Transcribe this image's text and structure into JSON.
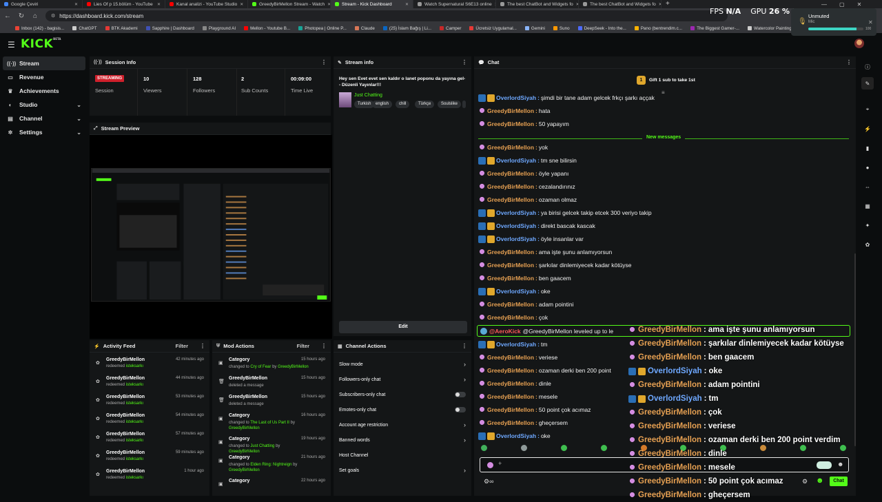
{
  "browser": {
    "tabs": [
      {
        "title": "Google Çeviri",
        "color": "#4285f4",
        "active": false
      },
      {
        "title": "Lies Of p 15.bölüm - YouTube",
        "color": "#ff0000",
        "active": false
      },
      {
        "title": "Kanal analizi - YouTube Studio",
        "color": "#ff0000",
        "active": false
      },
      {
        "title": "GreedyBirMellon Stream - Watch",
        "color": "#53fc18",
        "active": false
      },
      {
        "title": "Stream - Kick Dashboard",
        "color": "#53fc18",
        "active": true
      },
      {
        "title": "Watch Supernatural S6E13 online",
        "color": "#999999",
        "active": false
      },
      {
        "title": "The best ChatBot and Widgets fo",
        "color": "#999999",
        "active": false
      },
      {
        "title": "The best ChatBot and Widgets fo",
        "color": "#999999",
        "active": false
      }
    ],
    "url": "https://dashboard.kick.com/stream",
    "bookmarks": [
      {
        "label": "Inbox (142) - bagisis...",
        "color": "#ea4335"
      },
      {
        "label": "ChatGPT",
        "color": "#cccccc"
      },
      {
        "label": "BTK Akademi",
        "color": "#e53935"
      },
      {
        "label": "Sapphire | Dashboard",
        "color": "#3f51b5"
      },
      {
        "label": "Playground AI",
        "color": "#888888"
      },
      {
        "label": "Mellon - Youtube B...",
        "color": "#ff0000"
      },
      {
        "label": "Photopea | Online P...",
        "color": "#18a497"
      },
      {
        "label": "Claude",
        "color": "#d97757"
      },
      {
        "label": "(25) İslam Bağış | Li...",
        "color": "#0a66c2"
      },
      {
        "label": "Camper",
        "color": "#c62828"
      },
      {
        "label": "Ücretsiz Uygulamal...",
        "color": "#e53935"
      },
      {
        "label": "Gemini",
        "color": "#8ab4f8"
      },
      {
        "label": "Suno",
        "color": "#ff9800"
      },
      {
        "label": "DeepSeek - Into the...",
        "color": "#4d6bfe"
      },
      {
        "label": "Pano (bentrendim.c...",
        "color": "#ffb300"
      },
      {
        "label": "The Biggest Gamer-...",
        "color": "#9c27b0"
      },
      {
        "label": "Watercolor Painting...",
        "color": "#cccccc"
      },
      {
        "label": "AI Image Gener...",
        "color": "#cccccc"
      }
    ]
  },
  "overlay": {
    "fps_label": "FPS",
    "fps_value": "N/A",
    "gpu_label": "GPU",
    "gpu_value": "26 %",
    "gpu_extra": "50",
    "mic_title": "Unmuted",
    "mic_sub": "Mic",
    "mic_level_pct": 88,
    "mic_value": "100"
  },
  "app": {
    "logo": "KICK",
    "logo_badge": "BETA",
    "sidebar": [
      {
        "label": "Stream",
        "icon": "broadcast-icon",
        "glyph": "((·))",
        "active": true,
        "expand": false
      },
      {
        "label": "Revenue",
        "icon": "revenue-icon",
        "glyph": "▭",
        "active": false,
        "expand": false
      },
      {
        "label": "Achievements",
        "icon": "trophy-icon",
        "glyph": "♛",
        "active": false,
        "expand": false
      },
      {
        "label": "Studio",
        "icon": "studio-icon",
        "glyph": "◐",
        "active": false,
        "expand": true
      },
      {
        "label": "Channel",
        "icon": "channel-icon",
        "glyph": "▤",
        "active": false,
        "expand": true
      },
      {
        "label": "Settings",
        "icon": "gear-icon",
        "glyph": "✲",
        "active": false,
        "expand": true
      }
    ]
  },
  "session": {
    "title": "Session Info",
    "status": "STREAMING",
    "session_label": "Session",
    "stats": [
      {
        "value": "10",
        "label": "Viewers"
      },
      {
        "value": "128",
        "label": "Followers"
      },
      {
        "value": "2",
        "label": "Sub Counts"
      },
      {
        "value": "00:09:00",
        "label": "Time Live"
      }
    ]
  },
  "stream_info": {
    "title": "Stream info",
    "stream_title": "Hey sen Evet evet sen kaldır o lanet poponu da yayına gel- - Düzenli Yayınlar!!!",
    "category": "Just Chatting",
    "tags": [
      "Turkish",
      "english",
      "chill",
      "Türkçe",
      "Soulslike"
    ],
    "edit_label": "Edit"
  },
  "preview": {
    "title": "Stream Preview"
  },
  "activity": {
    "title": "Activity Feed",
    "filter": "Filter",
    "items": [
      {
        "user": "GreedyBirMellon",
        "action": "redeemed",
        "reward": "isteksarkı",
        "time": "42 minutes ago"
      },
      {
        "user": "GreedyBirMellon",
        "action": "redeemed",
        "reward": "isteksarkı",
        "time": "44 minutes ago"
      },
      {
        "user": "GreedyBirMellon",
        "action": "redeemed",
        "reward": "isteksarkı",
        "time": "53 minutes ago"
      },
      {
        "user": "GreedyBirMellon",
        "action": "redeemed",
        "reward": "isteksarkı",
        "time": "54 minutes ago"
      },
      {
        "user": "GreedyBirMellon",
        "action": "redeemed",
        "reward": "isteksarkı",
        "time": "57 minutes ago"
      },
      {
        "user": "GreedyBirMellon",
        "action": "redeemed",
        "reward": "isteksarkı",
        "time": "59 minutes ago"
      },
      {
        "user": "GreedyBirMellon",
        "action": "redeemed",
        "reward": "isteksarkı",
        "time": "1 hour ago"
      }
    ]
  },
  "mod_actions": {
    "title": "Mod Actions",
    "filter": "Filter",
    "items": [
      {
        "head": "Category",
        "pre": "changed to",
        "target": "Cry of Fear",
        "mid": "by",
        "by": "GreedyBirMellon",
        "time": "15 hours ago",
        "icon": "category-icon",
        "glyph": "▣"
      },
      {
        "head": "GreedyBirMellon",
        "pre": "deleted a message",
        "target": "",
        "mid": "",
        "by": "",
        "time": "15 hours ago",
        "icon": "trash-icon",
        "glyph": "🗑"
      },
      {
        "head": "GreedyBirMellon",
        "pre": "deleted a message",
        "target": "",
        "mid": "",
        "by": "",
        "time": "15 hours ago",
        "icon": "trash-icon",
        "glyph": "🗑"
      },
      {
        "head": "Category",
        "pre": "changed to",
        "target": "The Last of Us Part II",
        "mid": "by",
        "by": "GreedyBirMellon",
        "time": "16 hours ago",
        "icon": "category-icon",
        "glyph": "▣"
      },
      {
        "head": "Category",
        "pre": "changed to",
        "target": "Just Chatting",
        "mid": "by",
        "by": "GreedyBirMellon",
        "time": "19 hours ago",
        "icon": "category-icon",
        "glyph": "▣"
      },
      {
        "head": "Category",
        "pre": "changed to",
        "target": "Elden Ring: Nightreign",
        "mid": "by",
        "by": "GreedyBirMellon",
        "time": "21 hours ago",
        "icon": "category-icon",
        "glyph": "▣"
      },
      {
        "head": "Category",
        "pre": "",
        "target": "",
        "mid": "",
        "by": "",
        "time": "22 hours ago",
        "icon": "category-icon",
        "glyph": "▣"
      }
    ]
  },
  "channel_actions": {
    "title": "Channel Actions",
    "items": [
      {
        "label": "Slow mode",
        "control": "chevron"
      },
      {
        "label": "Followers-only chat",
        "control": "chevron"
      },
      {
        "label": "Subscribers-only chat",
        "control": "toggle"
      },
      {
        "label": "Emotes-only chat",
        "control": "toggle"
      },
      {
        "label": "Account age restriction",
        "control": "chevron"
      },
      {
        "label": "Banned words",
        "control": "chevron"
      },
      {
        "label": "Host Channel",
        "control": "none"
      },
      {
        "label": "Set goals",
        "control": "chevron"
      }
    ]
  },
  "chat": {
    "title": "Chat",
    "gift_label": "Gift 1 sub to take 1st",
    "gift_count": "1",
    "new_messages": "New messages",
    "send_label": "Chat",
    "colors": {
      "greedy": "#e6a052",
      "overlord": "#6ea8ff",
      "aero": "#ff5a5a",
      "accent": "#53fc18"
    },
    "messages_top": [
      {
        "user": "OverlordSiyah",
        "type": "overlord",
        "text": "şimdi bir tane adam gelcek frkçı şarkı aççak"
      },
      {
        "user": "GreedyBirMellon",
        "type": "greedy",
        "text": "hata"
      },
      {
        "user": "GreedyBirMellon",
        "type": "greedy",
        "text": "50 yapayım"
      }
    ],
    "messages": [
      {
        "user": "GreedyBirMellon",
        "type": "greedy",
        "text": "yok"
      },
      {
        "user": "OverlordSiyah",
        "type": "overlord",
        "text": "tm sne bilirsin"
      },
      {
        "user": "GreedyBirMellon",
        "type": "greedy",
        "text": "öyle yapanı"
      },
      {
        "user": "GreedyBirMellon",
        "type": "greedy",
        "text": "cezalandırınız"
      },
      {
        "user": "GreedyBirMellon",
        "type": "greedy",
        "text": "ozaman olmaz"
      },
      {
        "user": "OverlordSiyah",
        "type": "overlord",
        "text": "ya birisi gelcek takip etcek 300 veriyo takip"
      },
      {
        "user": "OverlordSiyah",
        "type": "overlord",
        "text": "direkt bascak kascak"
      },
      {
        "user": "OverlordSiyah",
        "type": "overlord",
        "text": "öyle insanlar var"
      },
      {
        "user": "GreedyBirMellon",
        "type": "greedy",
        "text": "ama işte şunu anlamıyorsun"
      },
      {
        "user": "GreedyBirMellon",
        "type": "greedy",
        "text": "şarkılar dinlemiyecek kadar kötüyse"
      },
      {
        "user": "GreedyBirMellon",
        "type": "greedy",
        "text": "ben gaacem"
      },
      {
        "user": "OverlordSiyah",
        "type": "overlord",
        "text": "oke"
      },
      {
        "user": "GreedyBirMellon",
        "type": "greedy",
        "text": "adam pointini"
      },
      {
        "user": "GreedyBirMellon",
        "type": "greedy",
        "text": "çok"
      }
    ],
    "levelup": {
      "user": "@AeroKick",
      "text": "@GreedyBirMellon leveled up to le"
    },
    "messages_bottom": [
      {
        "user": "OverlordSiyah",
        "type": "overlord",
        "text": "tm"
      },
      {
        "user": "GreedyBirMellon",
        "type": "greedy",
        "text": "veriese"
      },
      {
        "user": "GreedyBirMellon",
        "type": "greedy",
        "text": "ozaman derki ben 200 point"
      },
      {
        "user": "GreedyBirMellon",
        "type": "greedy",
        "text": "dinle"
      },
      {
        "user": "GreedyBirMellon",
        "type": "greedy",
        "text": "mesele"
      },
      {
        "user": "GreedyBirMellon",
        "type": "greedy",
        "text": "50 point çok acımaz"
      },
      {
        "user": "GreedyBirMellon",
        "type": "greedy",
        "text": "gheçersem"
      },
      {
        "user": "OverlordSiyah",
        "type": "overlord",
        "text": "oke"
      }
    ],
    "overlay_messages": [
      {
        "user": "GreedyBirMellon",
        "type": "greedy",
        "text": "ama işte şunu anlamıyorsun"
      },
      {
        "user": "GreedyBirMellon",
        "type": "greedy",
        "text": "şarkılar dinlemiyecek kadar kötüyse"
      },
      {
        "user": "GreedyBirMellon",
        "type": "greedy",
        "text": "ben gaacem"
      },
      {
        "user": "OverlordSiyah",
        "type": "overlord",
        "text": "oke"
      },
      {
        "user": "GreedyBirMellon",
        "type": "greedy",
        "text": "adam pointini"
      },
      {
        "user": "OverlordSiyah",
        "type": "overlord",
        "text": "tm"
      },
      {
        "user": "GreedyBirMellon",
        "type": "greedy",
        "text": "çok"
      },
      {
        "user": "GreedyBirMellon",
        "type": "greedy",
        "text": "veriese"
      },
      {
        "user": "GreedyBirMellon",
        "type": "greedy",
        "text": "ozaman derki ben 200 point verdim"
      },
      {
        "user": "GreedyBirMellon",
        "type": "greedy",
        "text": "dinle"
      },
      {
        "user": "GreedyBirMellon",
        "type": "greedy",
        "text": "mesele"
      },
      {
        "user": "GreedyBirMellon",
        "type": "greedy",
        "text": "50 point çok acımaz"
      },
      {
        "user": "GreedyBirMellon",
        "type": "greedy",
        "text": "gheçersem"
      }
    ]
  }
}
